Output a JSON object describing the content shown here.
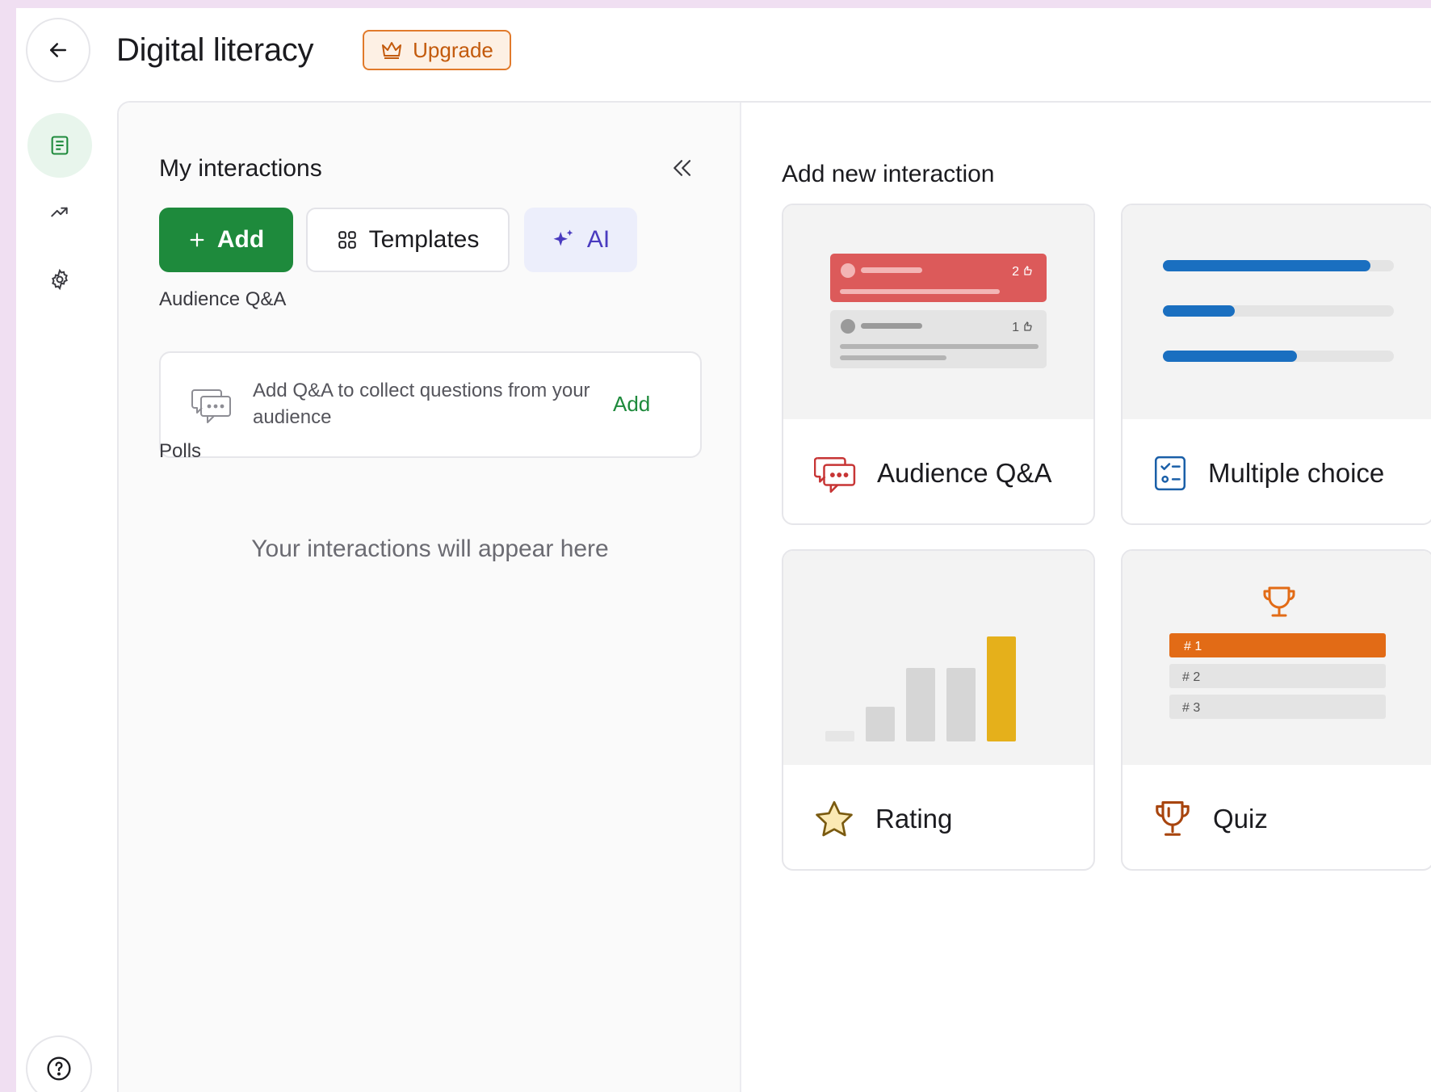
{
  "header": {
    "title": "Digital literacy",
    "upgrade_label": "Upgrade"
  },
  "rail": {
    "items": [
      "content-icon",
      "trend-up-icon",
      "gear-icon"
    ],
    "help_icon": "question-icon"
  },
  "panel": {
    "title": "My interactions",
    "add_label": "Add",
    "templates_label": "Templates",
    "ai_label": "AI",
    "sections": {
      "qa": {
        "label": "Audience Q&A",
        "card_text": "Add Q&A to collect questions from your audience",
        "card_action": "Add"
      },
      "polls": {
        "label": "Polls",
        "empty_text": "Your interactions will appear here"
      }
    }
  },
  "add_new": {
    "title": "Add new interaction",
    "types": [
      {
        "label": "Audience Q&A",
        "icon": "chat-bubble-icon"
      },
      {
        "label": "Multiple choice",
        "icon": "checklist-icon"
      },
      {
        "label": "Rating",
        "icon": "star-icon"
      },
      {
        "label": "Quiz",
        "icon": "trophy-icon"
      }
    ],
    "previews": {
      "qa_votes": [
        "2",
        "1"
      ],
      "quiz_ranks": [
        "# 1",
        "# 2",
        "# 3"
      ],
      "multiple_choice_levels": [
        0.9,
        0.31,
        0.58
      ],
      "rating_levels": [
        0.1,
        0.33,
        0.7,
        0.7,
        1.0
      ]
    }
  },
  "colors": {
    "primary_green": "#1e8a3c",
    "upgrade_orange": "#e17a2b",
    "qa_red": "#dc5a5a",
    "mc_blue": "#1a6fc0",
    "rating_yellow": "#e5b01b",
    "quiz_orange": "#e26b16",
    "ai_purple": "#4a3bbf"
  }
}
